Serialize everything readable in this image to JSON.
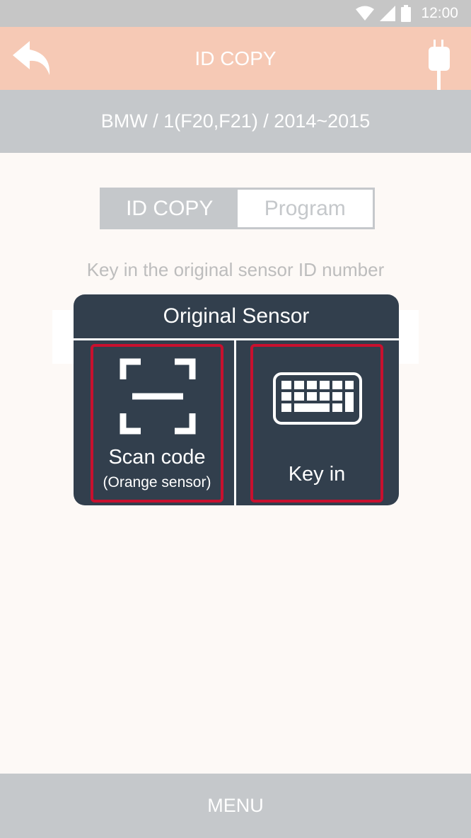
{
  "status_bar": {
    "time": "12:00",
    "icons": [
      "wifi-icon",
      "signal-icon",
      "battery-icon"
    ]
  },
  "header": {
    "title": "ID COPY",
    "back_icon": "back-arrow-icon",
    "connection_icon": "usb-plug-icon"
  },
  "breadcrumb": {
    "text": "BMW / 1(F20,F21) / 2014~2015"
  },
  "tabs": [
    {
      "label": "ID COPY",
      "active": true
    },
    {
      "label": "Program",
      "active": false
    }
  ],
  "instruction": "Key in the original sensor ID number",
  "dialog": {
    "title": "Original Sensor",
    "options": [
      {
        "label": "Scan code",
        "sublabel": "(Orange sensor)",
        "icon": "scan-code-icon"
      },
      {
        "label": "Key in",
        "icon": "keyboard-icon"
      }
    ]
  },
  "menu": {
    "label": "MENU"
  },
  "colors": {
    "header_bg": "#f6c9b5",
    "bar_gray": "#c5c8cb",
    "dialog_bg": "#323f4d",
    "highlight_border": "#c8102e",
    "page_bg": "#fdf9f6"
  }
}
